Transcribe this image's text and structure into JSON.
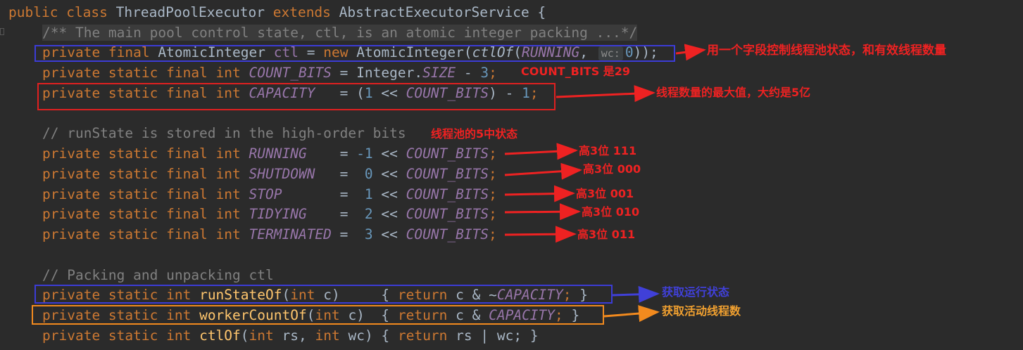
{
  "code": {
    "class_decl": {
      "kw1": "public",
      "kw2": "class",
      "name": "ThreadPoolExecutor",
      "kw3": "extends",
      "parent": "AbstractExecutorService",
      "brace": "{"
    },
    "doc_comment": "/** The main pool control state, ctl, is an atomic integer packing ...*/",
    "ctl_line": {
      "mods": "private final",
      "type": "AtomicInteger",
      "var": "ctl",
      "eq": "=",
      "new_kw": "new",
      "ctor": "AtomicInteger(",
      "fn": "ctlOf",
      "lp": "(",
      "running": "RUNNING",
      "comma": ",",
      "hint": "wc:",
      "zero": "0",
      "end": "));"
    },
    "count_bits_line": {
      "mods": "private static final int",
      "name": "COUNT_BITS",
      "eq": "=",
      "rhs_type": "Integer.",
      "rhs_const": "SIZE",
      "minus": "-",
      "num": "3",
      "end": ";"
    },
    "capacity_line": {
      "mods": "private static final int",
      "name": "CAPACITY",
      "pad": "  ",
      "eq": "=",
      "lp": "(",
      "one": "1",
      "shift": "<<",
      "cb": "COUNT_BITS",
      "rp": ")",
      "minus": "-",
      "num": "1",
      "end": ";"
    },
    "runstate_comment": "// runState is stored in the high-order bits",
    "states": [
      {
        "name": "RUNNING",
        "pad": "   ",
        "val": "-1"
      },
      {
        "name": "SHUTDOWN",
        "pad": "  ",
        "val": " 0"
      },
      {
        "name": "STOP",
        "pad": "      ",
        "val": " 1"
      },
      {
        "name": "TIDYING",
        "pad": "   ",
        "val": " 2"
      },
      {
        "name": "TERMINATED",
        "pad": "",
        "val": " 3"
      }
    ],
    "state_mods": "private static final int",
    "state_eq": "=",
    "state_shift": "<<",
    "state_cb": "COUNT_BITS",
    "state_end": ";",
    "packing_comment": "// Packing and unpacking ctl",
    "runstateof": {
      "mods": "private static int",
      "fn": "runStateOf",
      "lp": "(",
      "ptype": "int",
      "param": "c)",
      "pad": "    ",
      "ob": "{",
      "ret": "return",
      "expr": "c & ~",
      "cap": "CAPACITY",
      "end": ";",
      "cb": "}"
    },
    "workercountof": {
      "mods": "private static int",
      "fn": "workerCountOf",
      "lp": "(",
      "ptype": "int",
      "param": "c)",
      "pad": " ",
      "ob": "{",
      "ret": "return",
      "expr": "c &",
      "cap": "CAPACITY",
      "end": ";",
      "cb": "}"
    },
    "ctlof": {
      "mods": "private static int",
      "fn": "ctlOf",
      "lp": "(",
      "ptype1": "int",
      "p1": "rs,",
      "ptype2": "int",
      "p2": "wc)",
      "ob": "{",
      "ret": "return",
      "expr": "rs | wc;",
      "cb": "}"
    }
  },
  "annotations": {
    "ctl_note": "用一个字段控制线程池状态，和有效线程数量",
    "count_bits_note": "COUNT_BITS 是29",
    "capacity_note": "线程数量的最大值，大约是5亿",
    "states_note": "线程池的5中状态",
    "state_bits": [
      "高3位 111",
      "高3位 000",
      "高3位 001",
      "高3位 010",
      "高3位 011"
    ],
    "runstate_note": "获取运行状态",
    "workercount_note": "获取活动线程数"
  },
  "colors": {
    "background": "#2b2b2b",
    "keyword": "#cc7832",
    "constant": "#9876aa",
    "method": "#ffc66d",
    "number": "#6897bb",
    "comment": "#808080",
    "text": "#a9b7c6",
    "annotation_red": "#ee2222",
    "annotation_blue": "#4040d8",
    "annotation_orange": "#f28a1e"
  }
}
